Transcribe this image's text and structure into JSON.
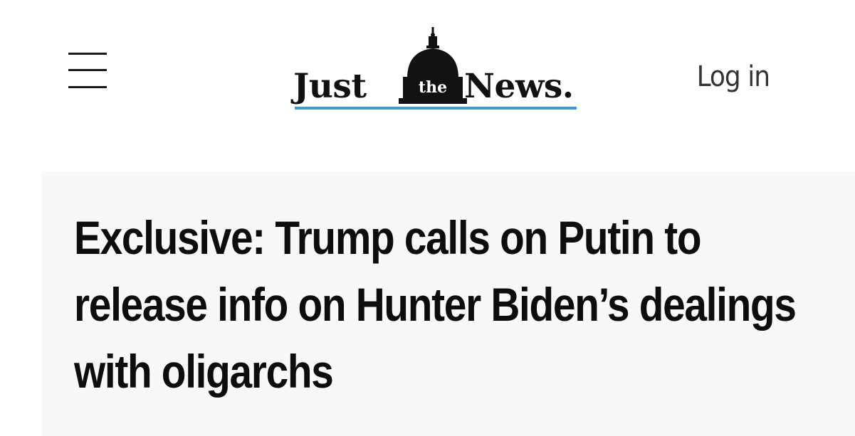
{
  "header": {
    "menu_icon": "hamburger-menu-icon",
    "logo": {
      "word_left": "Just",
      "word_middle": "the",
      "word_right": "News.",
      "icon": "capitol-dome-icon",
      "underline_color": "#3c9ccf"
    },
    "login_label": "Log in"
  },
  "article": {
    "headline": "Exclusive: Trump calls on Putin to release info on Hunter Biden’s dealings with oligarchs"
  }
}
